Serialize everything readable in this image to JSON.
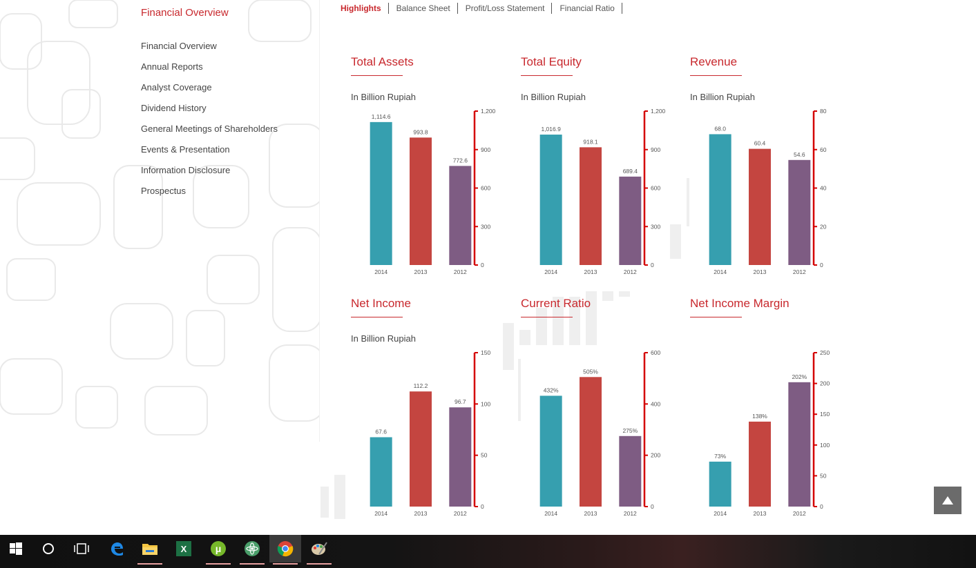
{
  "sidebar": {
    "title": "Financial Overview",
    "items": [
      {
        "label": "Financial Overview"
      },
      {
        "label": "Annual Reports"
      },
      {
        "label": "Analyst Coverage"
      },
      {
        "label": "Dividend History"
      },
      {
        "label": "General Meetings of Shareholders"
      },
      {
        "label": "Events & Presentation"
      },
      {
        "label": "Information Disclosure"
      },
      {
        "label": "Prospectus"
      }
    ]
  },
  "tabs": [
    {
      "label": "Highlights",
      "active": true
    },
    {
      "label": "Balance Sheet",
      "active": false
    },
    {
      "label": "Profit/Loss Statement",
      "active": false
    },
    {
      "label": "Financial Ratio",
      "active": false
    }
  ],
  "colors": {
    "accent": "#c8282d",
    "teal": "#369faf",
    "red": "#c44540",
    "purple": "#7e5c83",
    "axis": "#d40000"
  },
  "chart_data": [
    {
      "type": "bar",
      "title": "Total Assets",
      "unit": "In Billion Rupiah",
      "categories": [
        "2014",
        "2013",
        "2012"
      ],
      "values": [
        1114.6,
        993.8,
        772.6
      ],
      "labels": [
        "1,114.6",
        "993.8",
        "772.6"
      ],
      "ylim": [
        0,
        1200
      ],
      "ticks": [
        "0",
        "300",
        "600",
        "900",
        "1,200"
      ],
      "tick_values": [
        0,
        300,
        600,
        900,
        1200
      ]
    },
    {
      "type": "bar",
      "title": "Total Equity",
      "unit": "In Billion Rupiah",
      "categories": [
        "2014",
        "2013",
        "2012"
      ],
      "values": [
        1016.9,
        918.1,
        689.4
      ],
      "labels": [
        "1,016.9",
        "918.1",
        "689.4"
      ],
      "ylim": [
        0,
        1200
      ],
      "ticks": [
        "0",
        "300",
        "600",
        "900",
        "1,200"
      ],
      "tick_values": [
        0,
        300,
        600,
        900,
        1200
      ]
    },
    {
      "type": "bar",
      "title": "Revenue",
      "unit": "In Billion Rupiah",
      "categories": [
        "2014",
        "2013",
        "2012"
      ],
      "values": [
        68.0,
        60.4,
        54.6
      ],
      "labels": [
        "68.0",
        "60.4",
        "54.6"
      ],
      "ylim": [
        0,
        80
      ],
      "ticks": [
        "0",
        "20",
        "40",
        "60",
        "80"
      ],
      "tick_values": [
        0,
        20,
        40,
        60,
        80
      ]
    },
    {
      "type": "bar",
      "title": "Net Income",
      "unit": "In Billion Rupiah",
      "categories": [
        "2014",
        "2013",
        "2012"
      ],
      "values": [
        67.6,
        112.2,
        96.7
      ],
      "labels": [
        "67.6",
        "112.2",
        "96.7"
      ],
      "ylim": [
        0,
        150
      ],
      "ticks": [
        "0",
        "50",
        "100",
        "150"
      ],
      "tick_values": [
        0,
        50,
        100,
        150
      ]
    },
    {
      "type": "bar",
      "title": "Current Ratio",
      "unit": "",
      "categories": [
        "2014",
        "2013",
        "2012"
      ],
      "values": [
        432,
        505,
        275
      ],
      "labels": [
        "432%",
        "505%",
        "275%"
      ],
      "ylim": [
        0,
        600
      ],
      "ticks": [
        "0",
        "200",
        "400",
        "600"
      ],
      "tick_values": [
        0,
        200,
        400,
        600
      ]
    },
    {
      "type": "bar",
      "title": "Net Income Margin",
      "unit": "",
      "categories": [
        "2014",
        "2013",
        "2012"
      ],
      "values": [
        73,
        138,
        202
      ],
      "labels": [
        "73%",
        "138%",
        "202%"
      ],
      "ylim": [
        0,
        250
      ],
      "ticks": [
        "0",
        "50",
        "100",
        "150",
        "200",
        "250"
      ],
      "tick_values": [
        0,
        50,
        100,
        150,
        200,
        250
      ]
    }
  ],
  "taskbar": {
    "items": [
      {
        "name": "start-icon"
      },
      {
        "name": "cortana-icon"
      },
      {
        "name": "task-view-icon"
      },
      {
        "name": "edge-icon"
      },
      {
        "name": "file-explorer-icon"
      },
      {
        "name": "excel-icon"
      },
      {
        "name": "utorrent-icon"
      },
      {
        "name": "atom-icon"
      },
      {
        "name": "chrome-icon"
      },
      {
        "name": "paint-icon"
      }
    ]
  }
}
